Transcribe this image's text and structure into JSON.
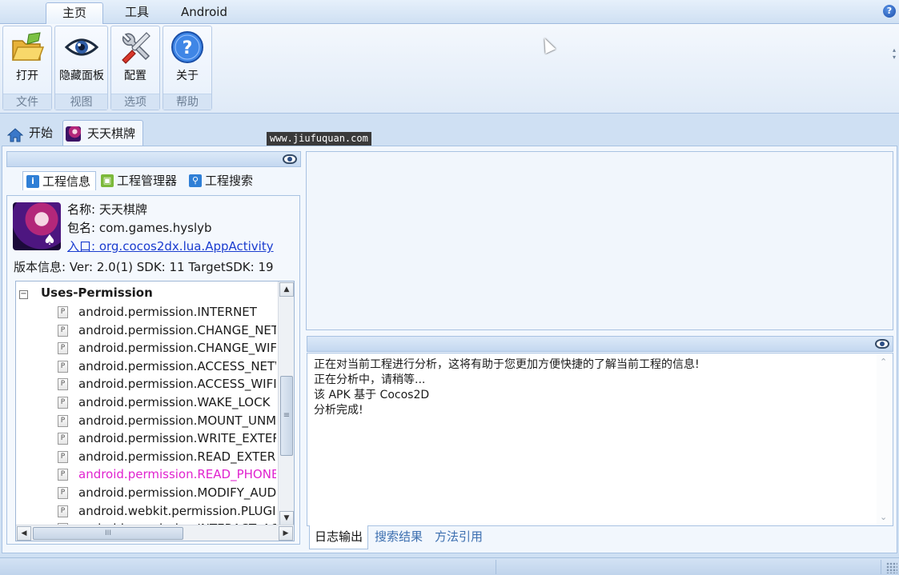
{
  "ribbon": {
    "tabs": [
      {
        "label": "主页"
      },
      {
        "label": "工具"
      },
      {
        "label": "Android"
      }
    ],
    "help_glyph": "?",
    "groups": [
      {
        "label": "文件",
        "button": {
          "label": "打开",
          "icon": "folder-open-icon"
        }
      },
      {
        "label": "视图",
        "button": {
          "label": "隐藏面板",
          "icon": "eye-icon"
        }
      },
      {
        "label": "选项",
        "button": {
          "label": "配置",
          "icon": "wrench-screwdriver-icon"
        }
      },
      {
        "label": "帮助",
        "button": {
          "label": "关于",
          "icon": "help-icon"
        }
      }
    ]
  },
  "doc_tabs": [
    {
      "label": "开始",
      "icon": "home-icon"
    },
    {
      "label": "天天棋牌",
      "icon": "app-icon"
    }
  ],
  "watermark": "www.jiufuquan.com",
  "left_panel": {
    "subtabs": [
      {
        "label": "工程信息",
        "icon": "info-icon"
      },
      {
        "label": "工程管理器",
        "icon": "android-icon"
      },
      {
        "label": "工程搜索",
        "icon": "search-icon"
      }
    ],
    "app": {
      "name_label": "名称:",
      "name": "天天棋牌",
      "package_label": "包名:",
      "package": "com.games.hyslyb",
      "entry": "入口: org.cocos2dx.lua.AppActivity",
      "version": "版本信息: Ver: 2.0(1) SDK: 11 TargetSDK: 19"
    },
    "tree": {
      "root": "Uses-Permission",
      "collapse_glyph": "−",
      "item_glyph": "P",
      "items": [
        "android.permission.INTERNET",
        "android.permission.CHANGE_NETW",
        "android.permission.CHANGE_WIFI",
        "android.permission.ACCESS_NETW",
        "android.permission.ACCESS_WIFI_",
        "android.permission.WAKE_LOCK",
        "android.permission.MOUNT_UNM",
        "android.permission.WRITE_EXTERI",
        "android.permission.READ_EXTERN",
        "android.permission.READ_PHONE_",
        "android.permission.MODIFY_AUDI",
        "android.webkit.permission.PLUGIN",
        "android.permission.INTERACT_AC"
      ],
      "highlight_index": 9,
      "highlight_color": "#e023cf"
    }
  },
  "log": {
    "lines": [
      "正在对当前工程进行分析，这将有助于您更加方便快捷的了解当前工程的信息!",
      "正在分析中，请稍等...",
      "该 APK 基于 Cocos2D",
      "分析完成!"
    ]
  },
  "bottom_tabs": [
    {
      "label": "日志输出"
    },
    {
      "label": "搜索结果"
    },
    {
      "label": "方法引用"
    }
  ],
  "colors": {
    "accent": "#1a3ccf",
    "chrome": "#cfe0f3"
  }
}
